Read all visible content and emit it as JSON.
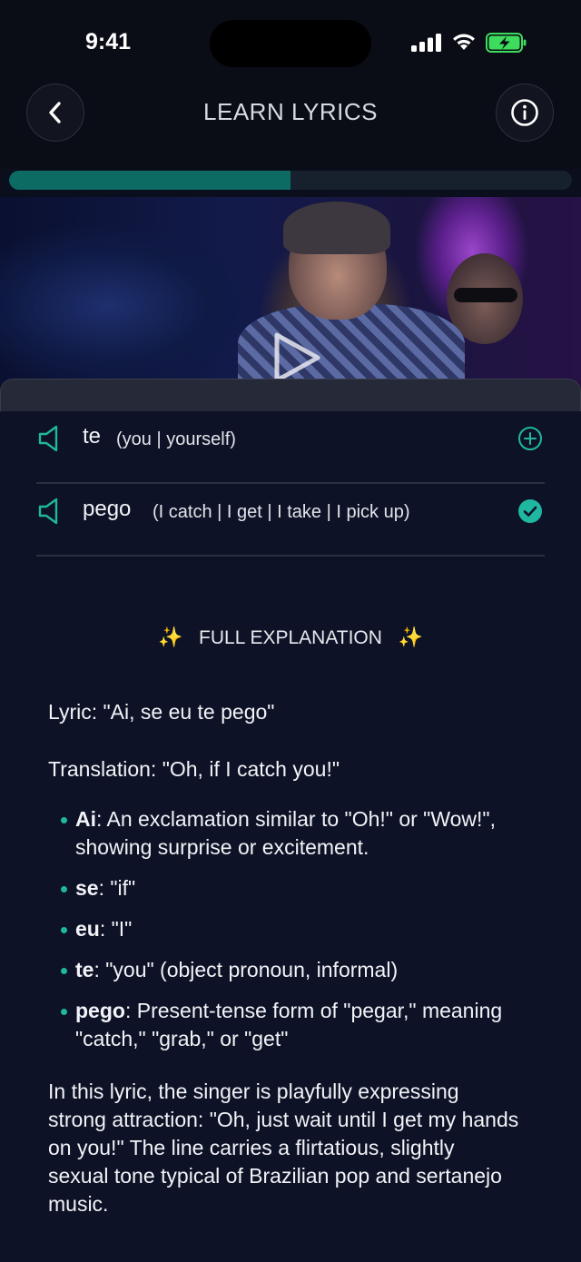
{
  "status_bar": {
    "time": "9:41"
  },
  "nav": {
    "title": "LEARN LYRICS",
    "back_icon": "chevron-left-icon",
    "info_icon": "info-circle-icon"
  },
  "progress": {
    "fraction": 0.5
  },
  "video": {
    "play_icon": "play-icon"
  },
  "words": [
    {
      "word": "te",
      "meaning": "(you | yourself)",
      "state": "add"
    },
    {
      "word": "pego",
      "meaning": "(I catch | I get | I take | I pick up)",
      "state": "added"
    }
  ],
  "explanation": {
    "heading": "FULL EXPLANATION",
    "sparkle": "✨",
    "lyric": "Lyric: \"Ai, se eu te pego\"",
    "translation": "Translation: \"Oh, if I catch you!\"",
    "bullets": [
      {
        "term": "Ai",
        "text": ": An exclamation similar to \"Oh!\" or \"Wow!\", showing surprise or excitement."
      },
      {
        "term": "se",
        "text": ": \"if\""
      },
      {
        "term": "eu",
        "text": ": \"I\""
      },
      {
        "term": "te",
        "text": ": \"you\" (object pronoun, informal)"
      },
      {
        "term": "pego",
        "text": ": Present-tense form of \"pegar,\" meaning \"catch,\" \"grab,\" or \"get\""
      }
    ],
    "summary": "In this lyric, the singer is playfully expressing strong attraction: \"Oh, just wait until I get my hands on you!\" The line carries a flirtatious, slightly sexual tone typical of Brazilian pop and sertanejo music."
  },
  "colors": {
    "accent": "#1fb7a0",
    "progress_fill": "#0c6b63",
    "background": "#0d1226"
  }
}
